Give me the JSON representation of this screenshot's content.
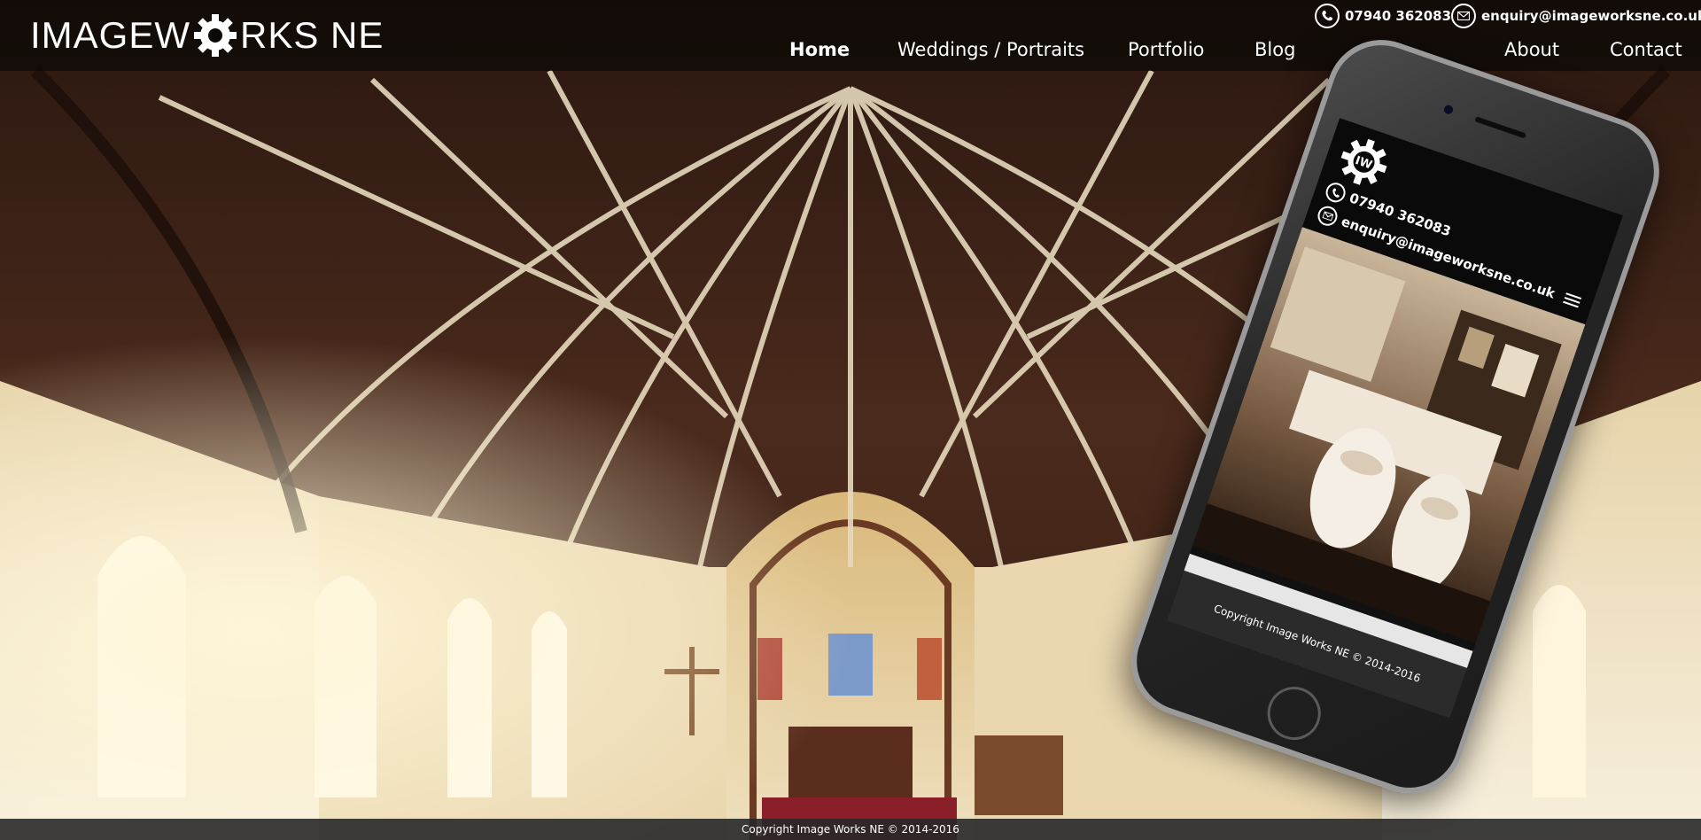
{
  "site": {
    "logo_text_left": "IMAGEW",
    "logo_text_right": "RKS NE",
    "phone": "07940 362083",
    "email": "enquiry@imageworksne.co.uk"
  },
  "nav": [
    {
      "label": "Home",
      "active": true
    },
    {
      "label": "Weddings / Portraits",
      "active": false
    },
    {
      "label": "Portfolio",
      "active": false
    },
    {
      "label": "Blog",
      "active": false
    },
    {
      "label": "About",
      "active": false
    },
    {
      "label": "Contact",
      "active": false
    }
  ],
  "footer": {
    "copyright": "Copyright Image Works NE © 2014-2016"
  },
  "mobile": {
    "logo_initials": "IW",
    "phone": "07940 362083",
    "email": "enquiry@imageworksne.co.uk",
    "footer": "Copyright Image Works NE © 2014-2016"
  },
  "colors": {
    "header_bg": "#0a0806",
    "roof_wood": "#3b2318",
    "wall": "#efe3c6",
    "accent_white": "#ffffff"
  }
}
